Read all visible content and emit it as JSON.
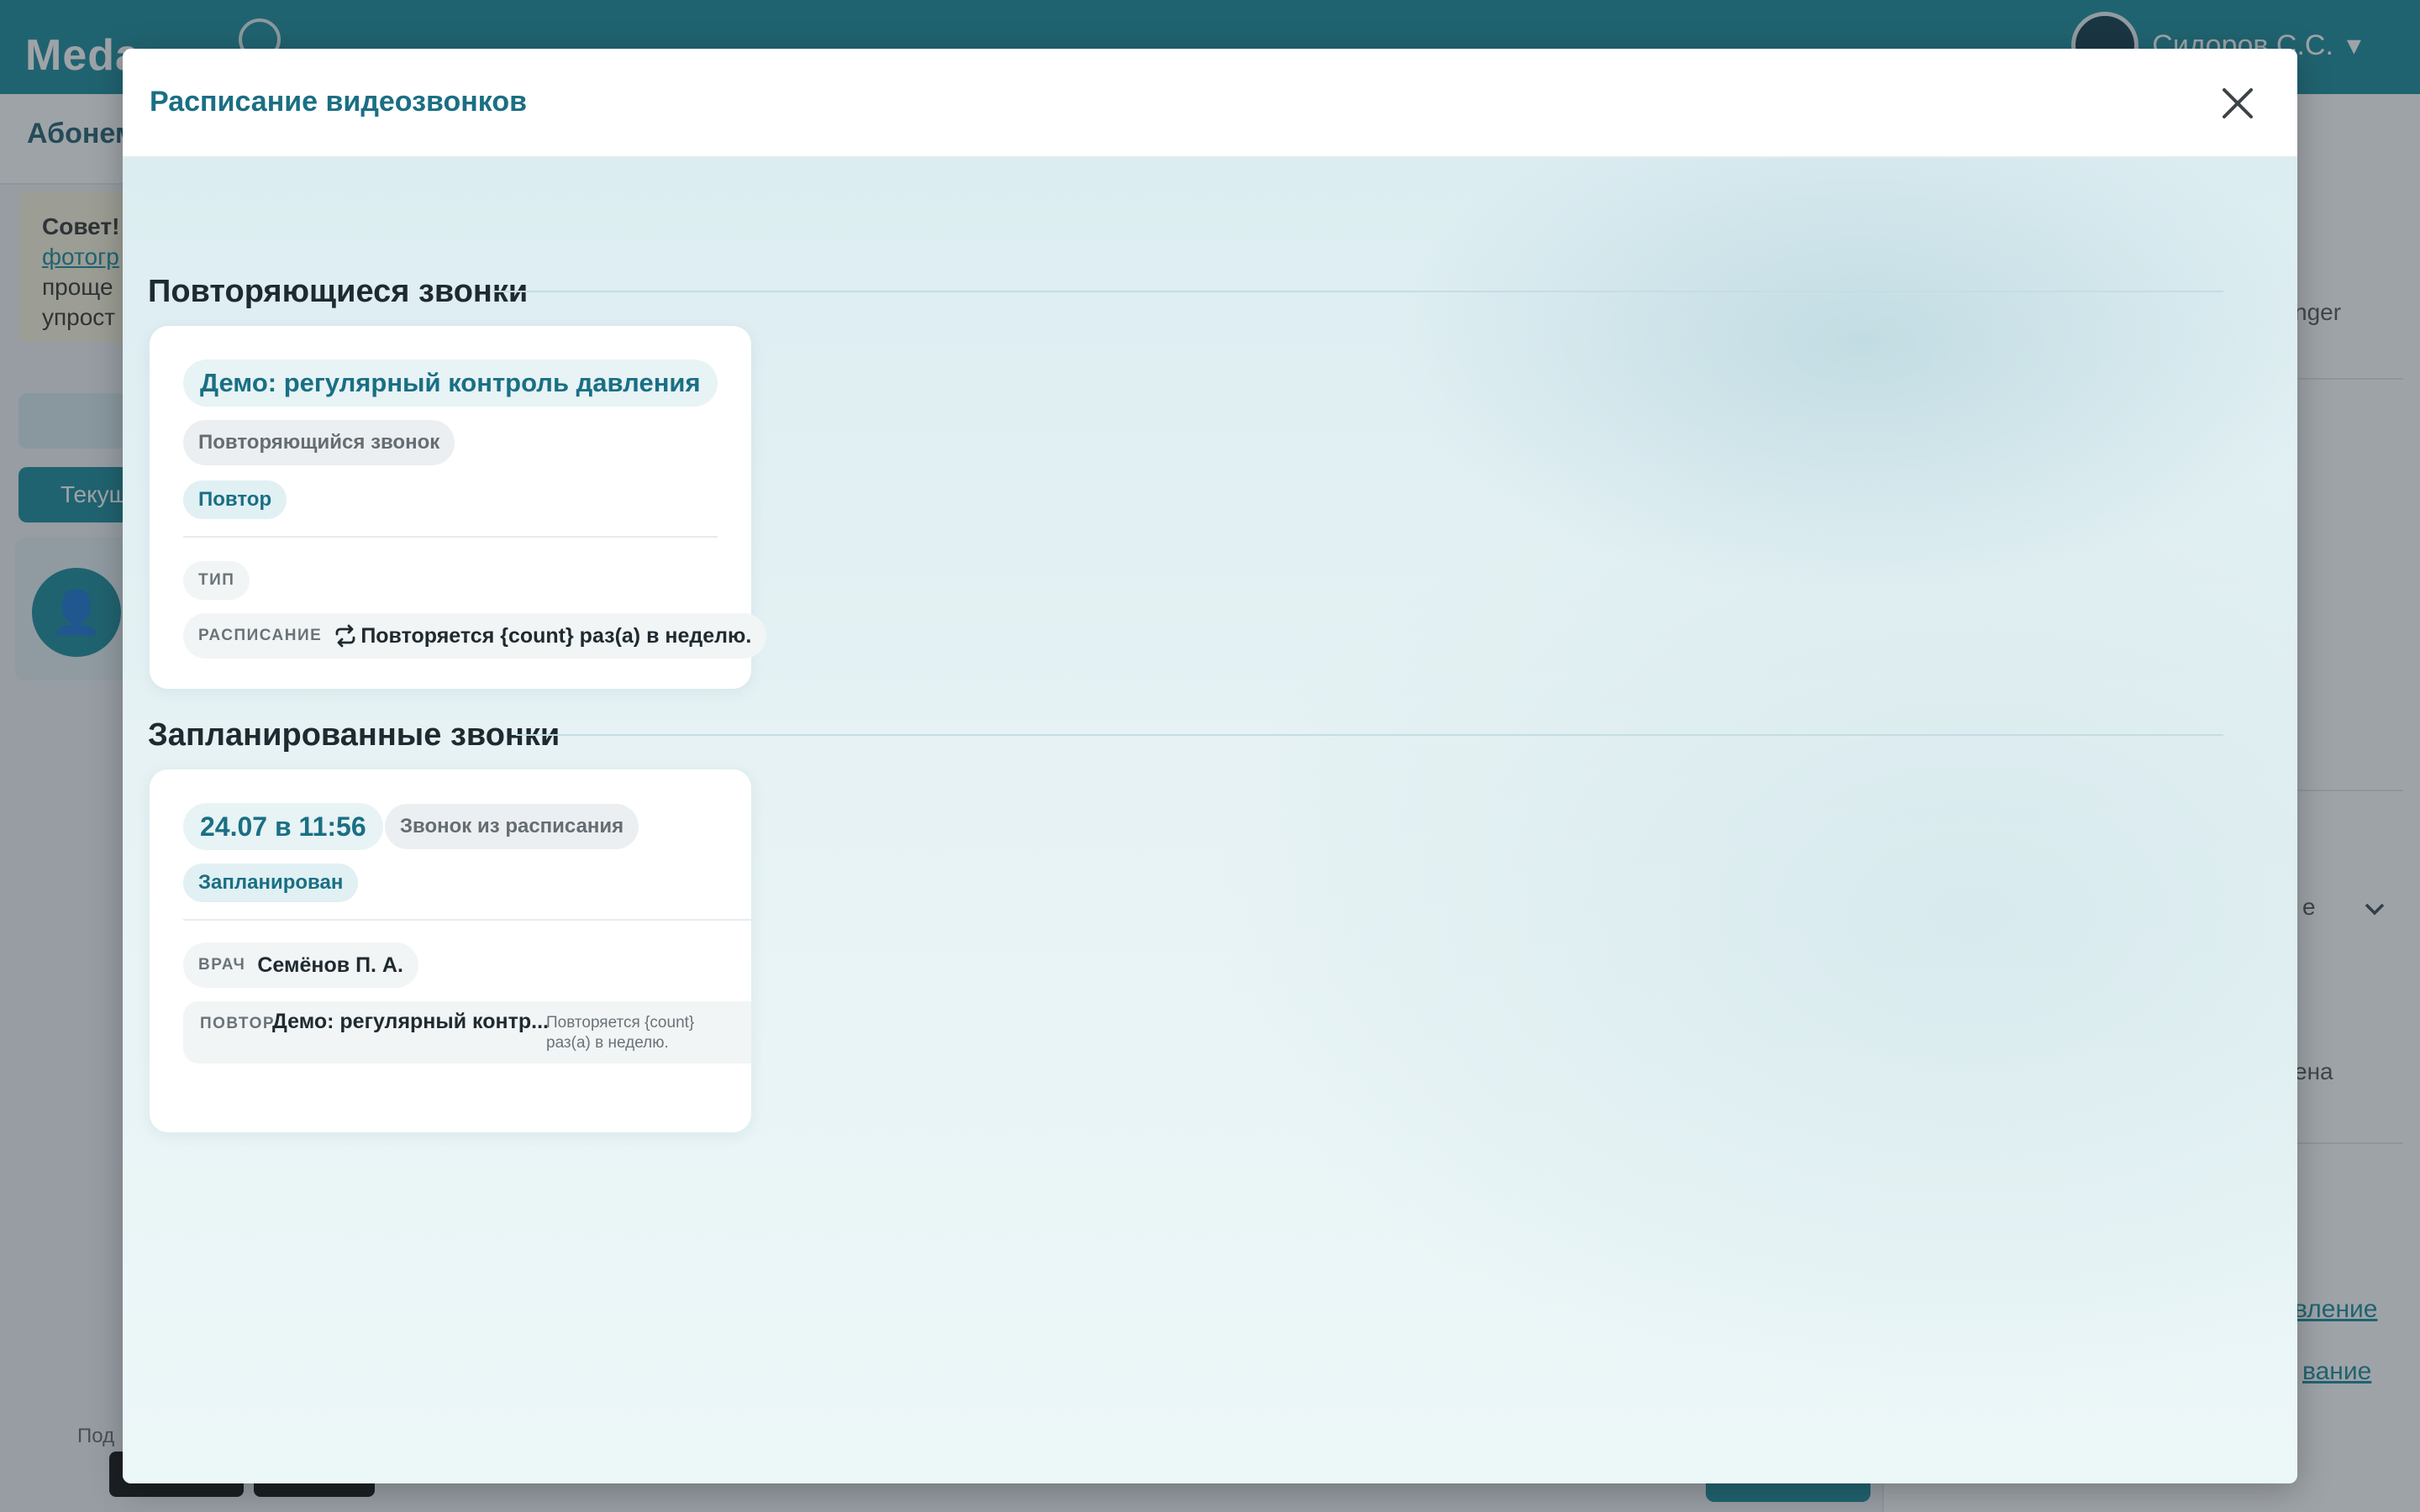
{
  "background": {
    "brand": "Meda",
    "user_name": "Сидоров С.С.",
    "user_caret": "▾",
    "subbar_title": "Абонем",
    "tip_lines": [
      "Совет!",
      "фотогр",
      "проще",
      "упрост"
    ],
    "left_button_label": "Текущ",
    "avatar_glyph": "👤",
    "right_texts": [
      "nger",
      "e",
      "ена"
    ],
    "right_links": [
      "вление",
      "вание"
    ],
    "bottom_label": "Под"
  },
  "modal": {
    "title": "Расписание видеозвонков",
    "close_icon": "close-icon"
  },
  "recurring": {
    "section_title": "Повторяющиеся звонки",
    "card": {
      "title": "Демо: регулярный контроль давления",
      "kind": "Повторяющийся звонок",
      "status": "Повтор",
      "type_label": "ТИП",
      "schedule_label": "РАСПИСАНИЕ",
      "schedule_icon": "repeat-icon",
      "schedule_value": "Повторяется {count} раз(а) в неделю."
    }
  },
  "scheduled": {
    "section_title": "Запланированные звонки",
    "card": {
      "datetime": "24.07 в 11:56",
      "source": "Звонок из расписания",
      "status": "Запланирован",
      "doctor_label": "ВРАЧ",
      "doctor_value": "Семёнов П. А.",
      "repeat_label": "ПОВТОР",
      "repeat_value": "Демо: регулярный контр...",
      "repeat_note": "Повторяется {count} раз(а) в неделю."
    }
  },
  "colors": {
    "brand": "#1b8a9c",
    "title_teal": "#1a6f84",
    "text_dark": "#1f2a30",
    "text_muted": "#6a7378"
  }
}
